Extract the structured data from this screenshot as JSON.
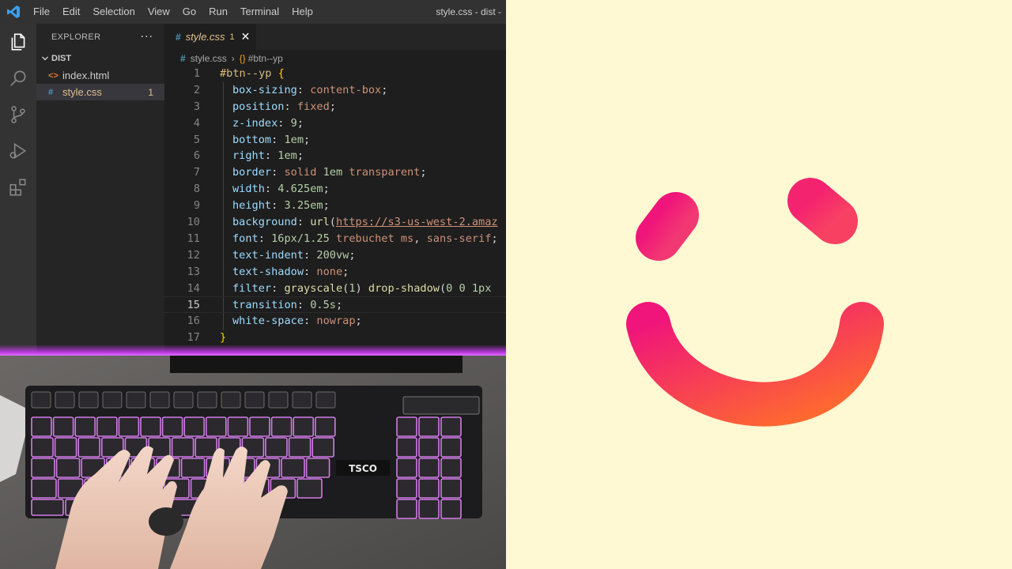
{
  "window": {
    "title": "style.css - dist - "
  },
  "menu": [
    "File",
    "Edit",
    "Selection",
    "View",
    "Go",
    "Run",
    "Terminal",
    "Help"
  ],
  "activity_bar": [
    {
      "icon": "files-icon",
      "active": true
    },
    {
      "icon": "search-icon"
    },
    {
      "icon": "source-control-icon"
    },
    {
      "icon": "run-debug-icon"
    },
    {
      "icon": "extensions-icon"
    }
  ],
  "explorer": {
    "title": "EXPLORER",
    "more": "···",
    "folder": "DIST",
    "files": [
      {
        "name": "index.html",
        "icon": "<>",
        "badge": ""
      },
      {
        "name": "style.css",
        "icon": "#",
        "badge": "1",
        "active": true
      }
    ]
  },
  "tab": {
    "icon": "#",
    "name": "style.css",
    "badge": "1",
    "close": "✕"
  },
  "breadcrumb": {
    "icon": "#",
    "file": "style.css",
    "separator": "›",
    "symbol_icon": "{}",
    "symbol": "#btn--yp"
  },
  "code": {
    "current_line": 15,
    "lines": [
      {
        "n": "1",
        "selector": "#btn--yp",
        "open": "{"
      },
      {
        "n": "2",
        "prop": "box-sizing",
        "value": "content-box"
      },
      {
        "n": "3",
        "prop": "position",
        "value": "fixed"
      },
      {
        "n": "4",
        "prop": "z-index",
        "value": "9"
      },
      {
        "n": "5",
        "prop": "bottom",
        "value": "1em"
      },
      {
        "n": "6",
        "prop": "right",
        "value": "1em"
      },
      {
        "n": "7",
        "prop": "border",
        "value": "solid 1em transparent"
      },
      {
        "n": "8",
        "prop": "width",
        "value": "4.625em"
      },
      {
        "n": "9",
        "prop": "height",
        "value": "3.25em"
      },
      {
        "n": "10",
        "prop": "background",
        "value": "url(https://s3-us-west-2.amaz"
      },
      {
        "n": "11",
        "prop": "font",
        "value": "16px/1.25 trebuchet ms, sans-serif;"
      },
      {
        "n": "12",
        "prop": "text-indent",
        "value": "200vw"
      },
      {
        "n": "13",
        "prop": "text-shadow",
        "value": "none"
      },
      {
        "n": "14",
        "prop": "filter",
        "value": "grayscale(1) drop-shadow(0 0 1px"
      },
      {
        "n": "15",
        "prop": "transition",
        "value": "0.5s"
      },
      {
        "n": "16",
        "prop": "white-space",
        "value": "nowrap"
      },
      {
        "n": "17",
        "close": "}"
      }
    ]
  },
  "photo": {
    "description_visible_text": "TSCO"
  },
  "colors": {
    "logo_gradient_start": "#f0157a",
    "logo_gradient_end": "#ff6d2c",
    "logo_background": "#fef8d3",
    "keyboard_glow": "#e070ff"
  }
}
